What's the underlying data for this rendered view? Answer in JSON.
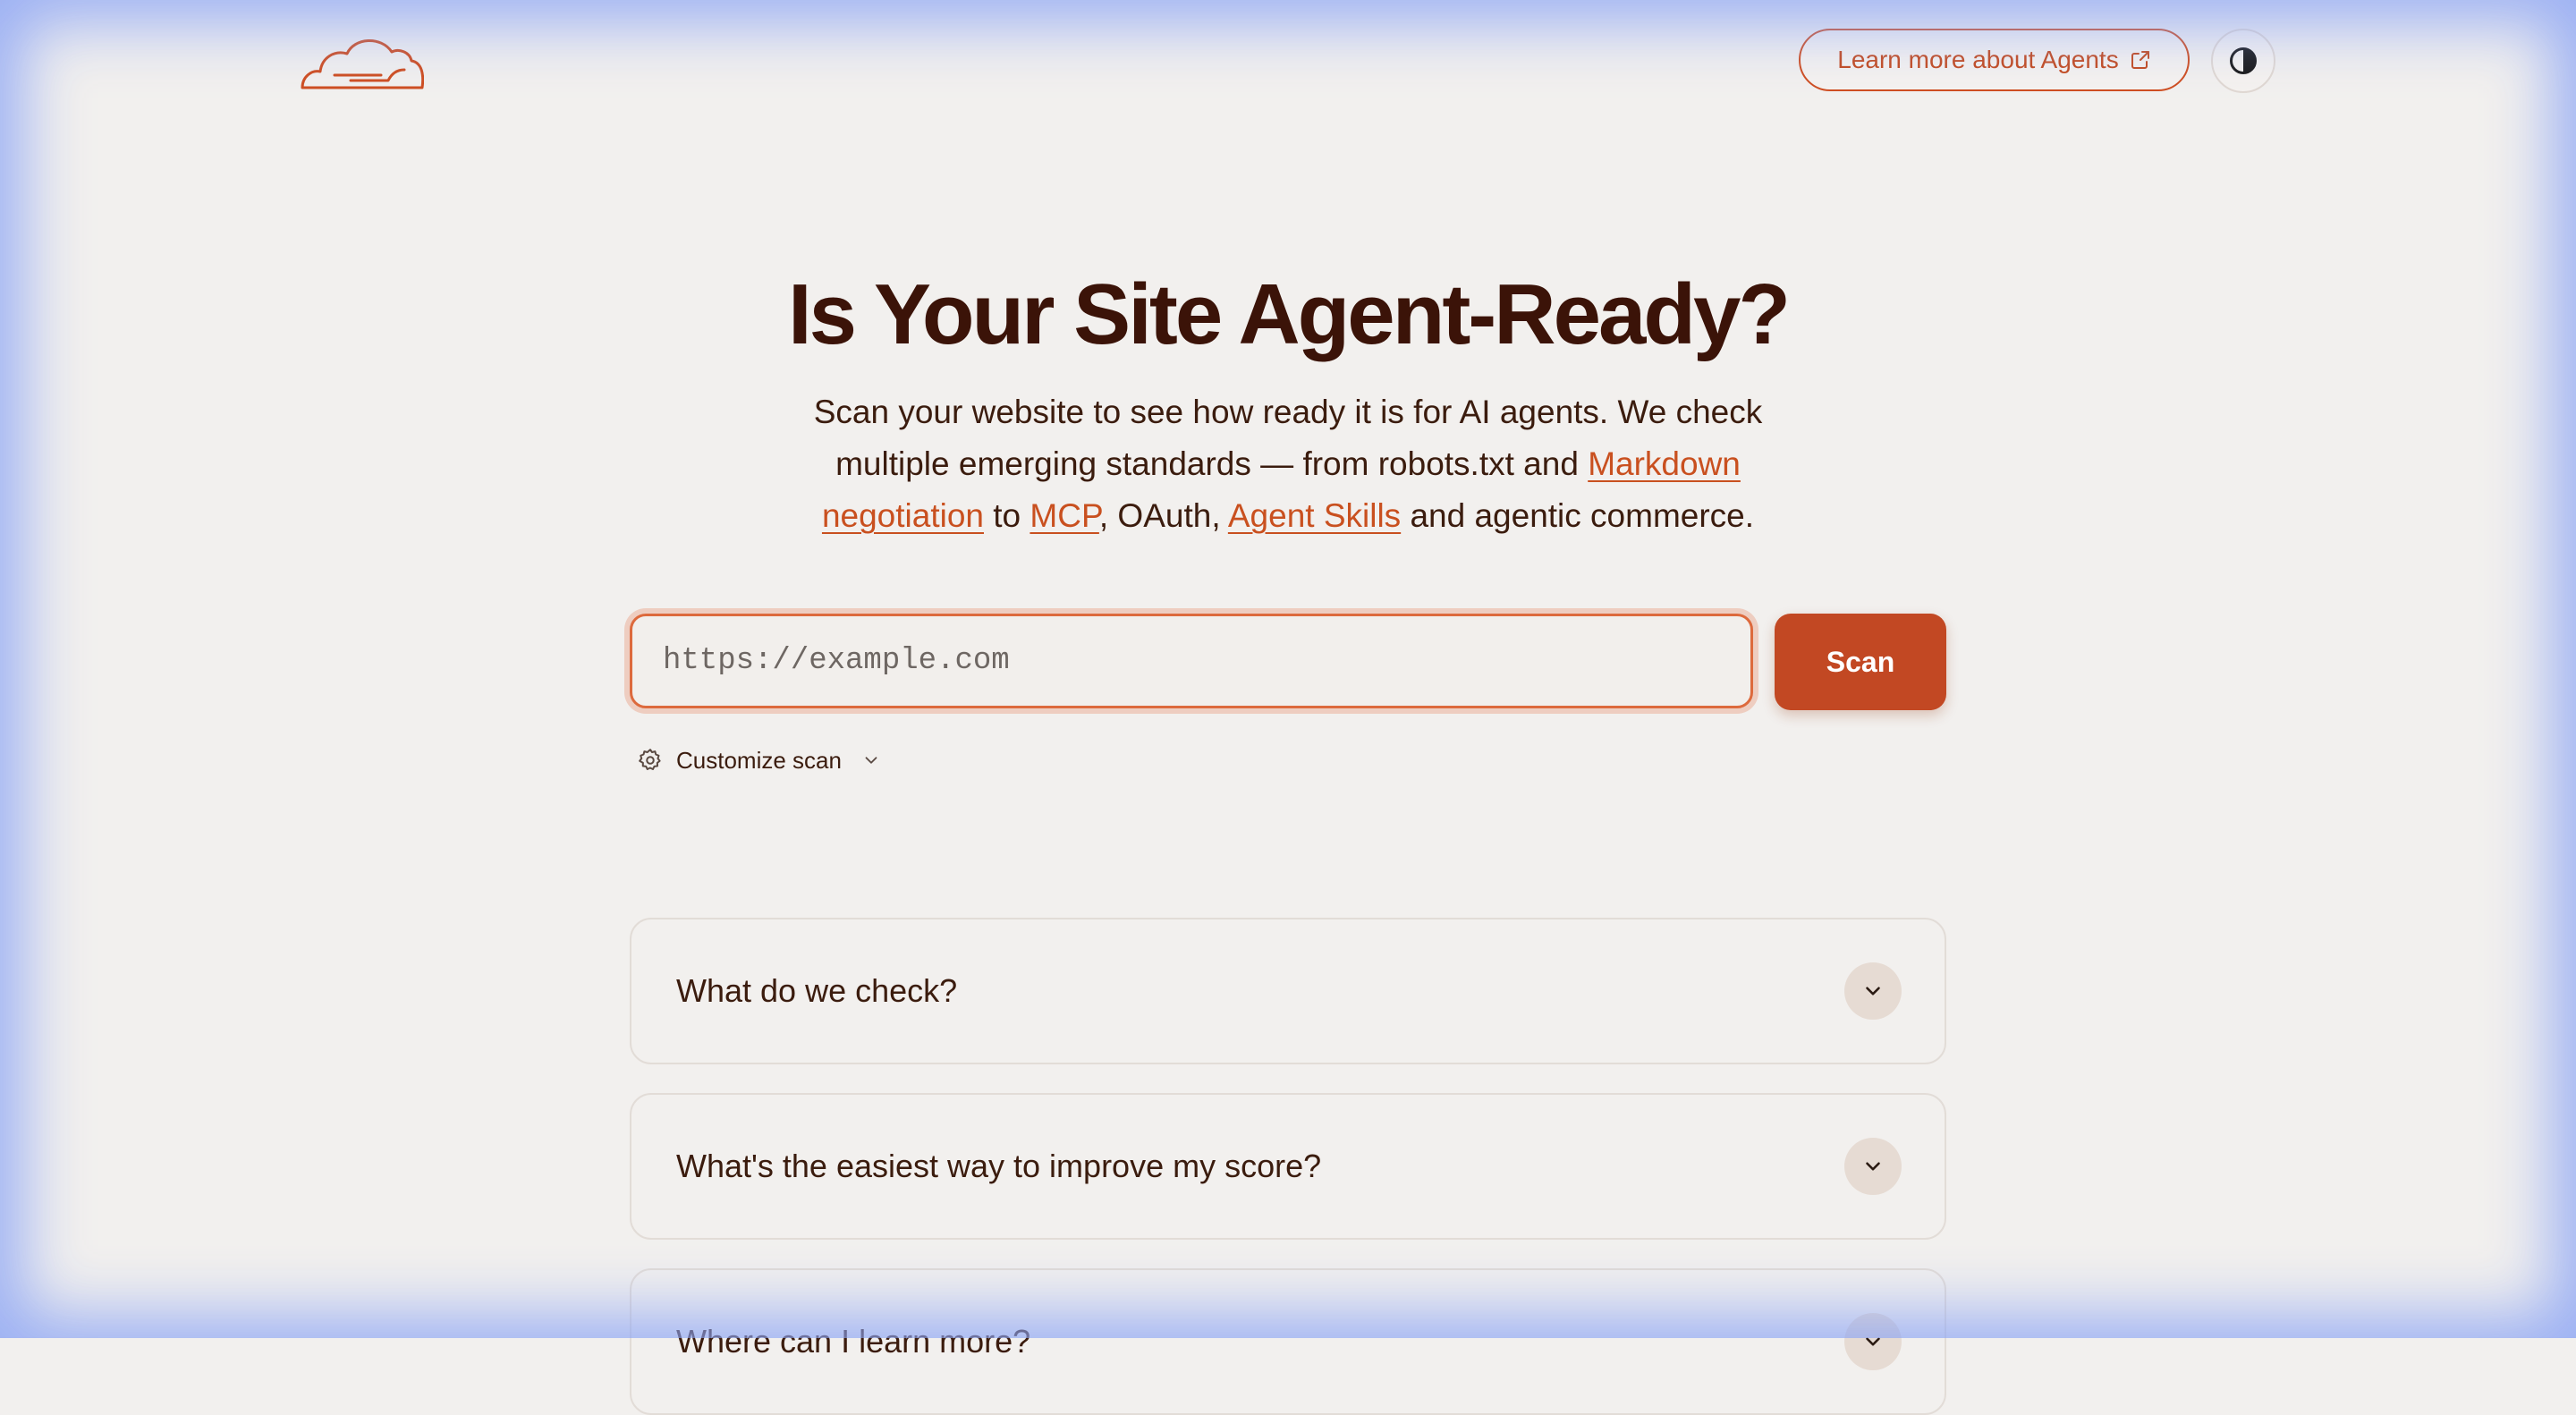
{
  "header": {
    "logo_icon": "cloudflare-cloud-logo",
    "learn_more_label": "Learn more about Agents",
    "learn_more_icon": "external-link-icon",
    "theme_toggle_icon": "contrast-icon"
  },
  "hero": {
    "title": "Is Your Site Agent-Ready?",
    "subtitle": {
      "part1": "Scan your website to see how ready it is for AI agents. We check multiple emerging standards — from robots.txt and ",
      "link_markdown": "Markdown negotiation",
      "part2": " to ",
      "link_mcp": "MCP",
      "part3": ", OAuth, ",
      "link_skills": "Agent Skills",
      "part4": " and agentic commerce."
    }
  },
  "scan": {
    "placeholder": "https://example.com",
    "value": "",
    "button_label": "Scan",
    "customize_label": "Customize scan",
    "customize_icon": "gear-icon"
  },
  "faq": [
    {
      "question": "What do we check?"
    },
    {
      "question": "What's the easiest way to improve my score?"
    },
    {
      "question": "Where can I learn more?"
    }
  ],
  "colors": {
    "accent": "#c24823",
    "link": "#c9501f",
    "title": "#3b1308",
    "background": "#f2f0ee"
  }
}
